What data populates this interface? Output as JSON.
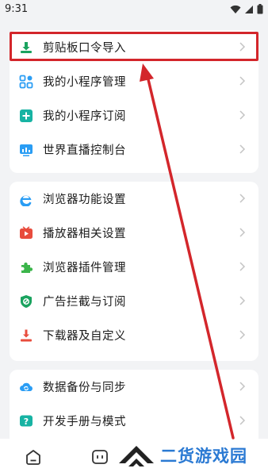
{
  "status_bar": {
    "time": "9:31"
  },
  "group1": [
    {
      "label": "剪贴板口令导入",
      "icon": "clipboard-import-icon",
      "color": "#1aa35f"
    },
    {
      "label": "我的小程序管理",
      "icon": "mini-program-grid-icon",
      "color": "#2a9df4"
    },
    {
      "label": "我的小程序订阅",
      "icon": "mini-program-subscribe-icon",
      "color": "#17b3a3"
    },
    {
      "label": "世界直播控制台",
      "icon": "live-console-icon",
      "color": "#2a9df4"
    }
  ],
  "group2": [
    {
      "label": "浏览器功能设置",
      "icon": "browser-e-icon",
      "color": "#2a9df4"
    },
    {
      "label": "播放器相关设置",
      "icon": "player-icon",
      "color": "#e84c3d"
    },
    {
      "label": "浏览器插件管理",
      "icon": "puzzle-plugin-icon",
      "color": "#3bb54a"
    },
    {
      "label": "广告拦截与订阅",
      "icon": "ad-block-shield-icon",
      "color": "#1aa35f"
    },
    {
      "label": "下载器及自定义",
      "icon": "download-icon",
      "color": "#e84c3d"
    }
  ],
  "group3": [
    {
      "label": "数据备份与同步",
      "icon": "cloud-sync-icon",
      "color": "#2a9df4"
    },
    {
      "label": "开发手册与模式",
      "icon": "manual-question-icon",
      "color": "#17b3a3"
    }
  ],
  "watermark": {
    "text": "二货游戏园"
  },
  "colors": {
    "annotation": "#d3262b",
    "background": "#f2f3f5"
  }
}
